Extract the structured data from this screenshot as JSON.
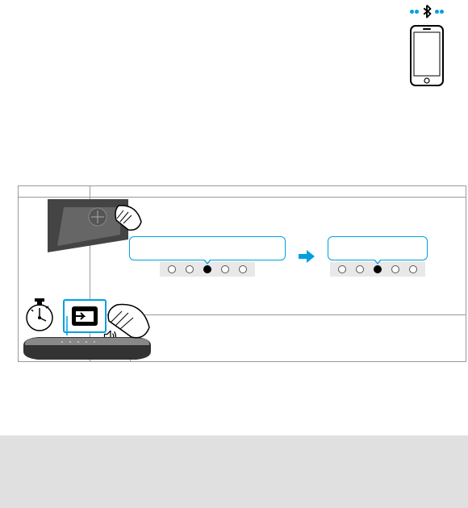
{
  "bluetooth": {
    "icon": "bluetooth-icon",
    "dots_color": "#00a0e0"
  },
  "phone": {
    "icon": "smartphone-icon"
  },
  "led_panel": {
    "left": {
      "pattern": [
        0,
        0,
        1,
        0,
        0
      ]
    },
    "right": {
      "pattern": [
        0,
        0,
        1,
        0,
        0
      ]
    },
    "arrow": "arrow-right",
    "arrow_color": "#00a0e0"
  },
  "speaker": {
    "icon": "speaker-icon"
  },
  "illustrations": {
    "top": "touch-soundbar-top-icon",
    "bottom": "press-source-button-icon",
    "timer": "stopwatch-icon",
    "source_button": "source-icon"
  }
}
